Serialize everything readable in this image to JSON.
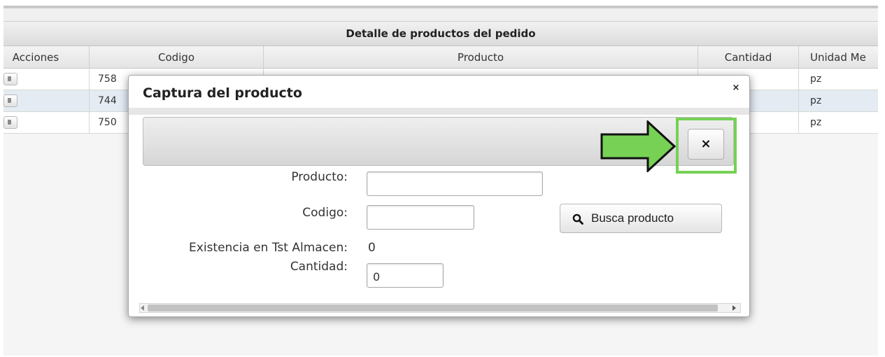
{
  "grid": {
    "caption": "Detalle de productos del pedido",
    "columns": [
      "Acciones",
      "Codigo",
      "Producto",
      "Cantidad",
      "Unidad Me"
    ],
    "rows": [
      {
        "codigo": "758",
        "unidad": "pz"
      },
      {
        "codigo": "744",
        "unidad": "pz"
      },
      {
        "codigo": "750",
        "unidad": "pz"
      }
    ]
  },
  "dialog": {
    "title": "Captura del producto",
    "close_icon": "×",
    "inner_close_icon": "×",
    "fields": {
      "producto_label": "Producto:",
      "producto_value": "",
      "codigo_label": "Codigo:",
      "codigo_value": "",
      "existencia_label": "Existencia en Tst Almacen:",
      "existencia_value": "0",
      "cantidad_label": "Cantidad:",
      "cantidad_value": "0"
    },
    "search_button": "Busca producto"
  },
  "icons": {
    "search_button_icon": "search-icon",
    "annotation_arrow": "arrow-right-icon"
  },
  "colors": {
    "highlight": "#76d155",
    "arrow_fill": "#76d155",
    "selected_row": "#e4ebf3"
  }
}
